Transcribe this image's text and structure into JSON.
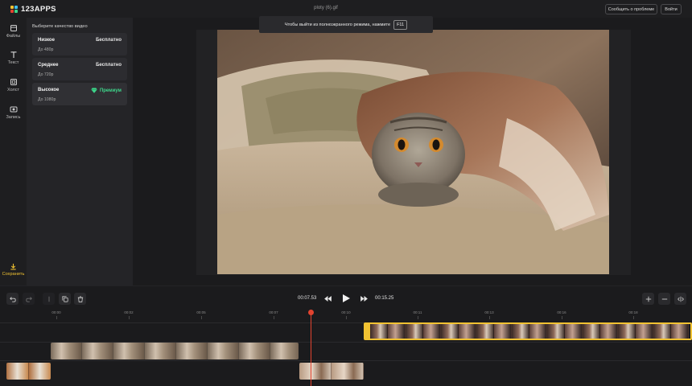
{
  "app": {
    "logo_text": "123APPS",
    "file_title": "ploty (6).gif",
    "report_button": "Сообщить о проблеме",
    "login_button": "Войти"
  },
  "fullscreen_hint": {
    "text": "Чтобы выйти из полноэкранного режима, нажмите",
    "key": "F11"
  },
  "sidebar": {
    "items": [
      {
        "label": "Файлы",
        "icon": "folder-icon"
      },
      {
        "label": "Текст",
        "icon": "text-icon"
      },
      {
        "label": "Холст",
        "icon": "canvas-icon"
      },
      {
        "label": "Запись",
        "icon": "record-icon"
      }
    ],
    "save_label": "Сохранить"
  },
  "quality_panel": {
    "title": "Выберите качество видео",
    "options": [
      {
        "name": "Низкое",
        "resolution": "До 480p",
        "price": "Бесплатно"
      },
      {
        "name": "Среднее",
        "resolution": "До 720p",
        "price": "Бесплатно"
      },
      {
        "name": "Высокое",
        "resolution": "До 1080p",
        "price": "Премиум"
      }
    ]
  },
  "player": {
    "current_time": "00:07.53",
    "total_time": "00:15.25"
  },
  "timeline": {
    "ticks": [
      "00:00",
      "00:02",
      "00:05",
      "00:07",
      "00:10",
      "00:11",
      "00:13",
      "00:16",
      "00:18"
    ]
  },
  "colors": {
    "accent_yellow": "#f1c232",
    "premium_green": "#3ed68b",
    "playhead_red": "#e3432f"
  }
}
